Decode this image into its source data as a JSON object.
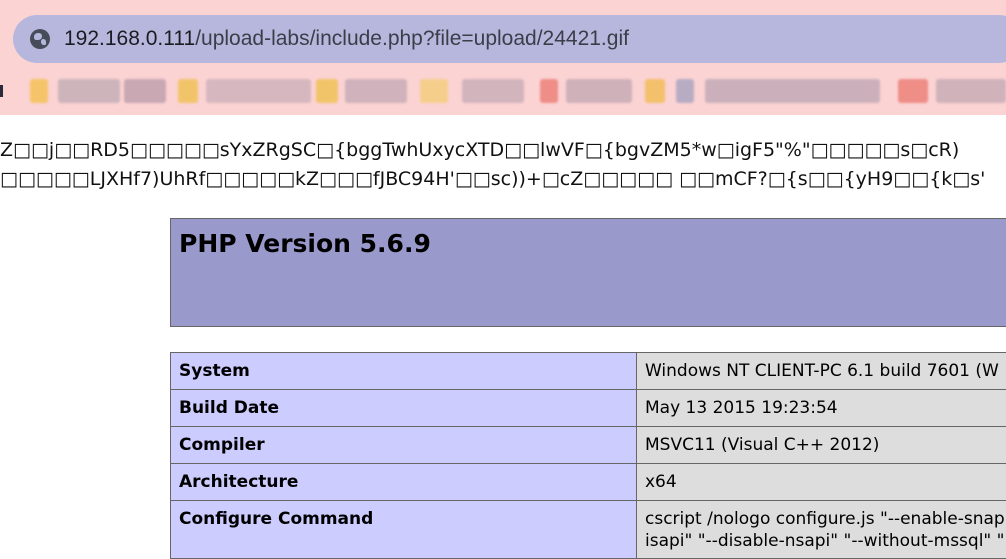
{
  "browser": {
    "url_host": "192.168.0.111",
    "url_path": "/upload-labs/include.php?file=upload/24421.gif",
    "site_icon": "globe-icon"
  },
  "garbage_text": {
    "line1": "Z□□j□□RD5□□□□□sYxZRgSC□{bggTwhUxycXTD□□lwVF□{bgvZM5*w□igF5\"%\"□□□□□s□cR)",
    "line2": "□□□□□LJXHf7)UhRf□□□□□kZ□□□fJBC94H'□□sc))+□cZ□□□□□ □□mCF?□{s□□{yH9□□{k□s'"
  },
  "phpinfo": {
    "title": "PHP Version 5.6.9",
    "rows": [
      {
        "key": "System",
        "value": "Windows NT CLIENT-PC 6.1 build 7601 (W"
      },
      {
        "key": "Build Date",
        "value": "May 13 2015 19:23:54"
      },
      {
        "key": "Compiler",
        "value": "MSVC11 (Visual C++ 2012)"
      },
      {
        "key": "Architecture",
        "value": "x64"
      },
      {
        "key": "Configure Command",
        "value": "cscript /nologo configure.js \"--enable-snap",
        "value_line2": "isapi\" \"--disable-nsapi\" \"--without-mssql\" \""
      }
    ]
  },
  "colors": {
    "header_bg": "#9999cc",
    "key_cell_bg": "#ccccff",
    "value_cell_bg": "#dddddd",
    "chrome_bg": "#fbd3d3",
    "omnibox_bg": "#b7b7dd"
  }
}
